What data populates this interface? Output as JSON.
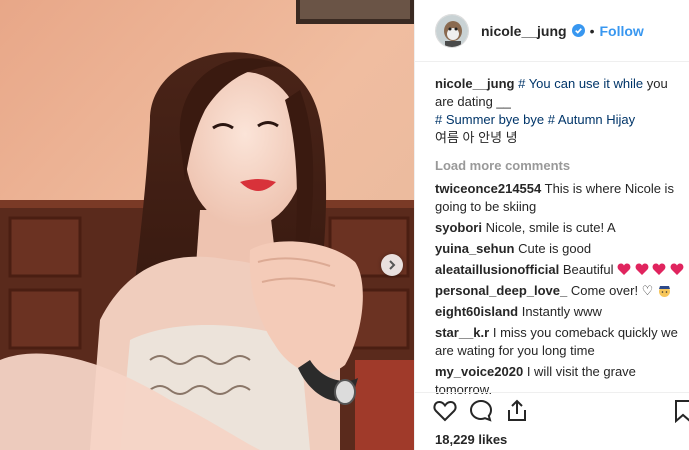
{
  "post": {
    "username": "nicole__jung",
    "follow_label": "Follow",
    "dot": "•",
    "caption": {
      "user": "nicole__jung",
      "parts": [
        "# You can use it",
        "while",
        "you are dating __"
      ],
      "line2": "# Summer bye bye # Autumn Hijay",
      "line3": "여름 아 안녕 녕"
    },
    "load_more": "Load more comments",
    "comments": [
      {
        "user": "twiceonce214554",
        "text": "This is where Nicole is going to be skiing"
      },
      {
        "user": "syobori",
        "text": "Nicole, smile is cute! A"
      },
      {
        "user": "yuina_sehun",
        "text": "Cute is good"
      },
      {
        "user": "aleataillusionofficial",
        "text": "Beautiful"
      },
      {
        "user": "personal_deep_love_",
        "text": "Come over! ♡"
      },
      {
        "user": "eight60island",
        "text": "Instantly www"
      },
      {
        "user": "star__k.r",
        "text": "I miss you comeback quickly we are wating for you long time"
      },
      {
        "user": "my_voice2020",
        "text": "I will visit the grave tomorrow."
      }
    ],
    "likes": "18,229 likes"
  },
  "icons": {
    "verified": "verified-badge-icon",
    "like": "heart-outline-icon",
    "comment": "speech-bubble-icon",
    "share": "share-upload-icon",
    "save": "bookmark-icon",
    "next": "chevron-right-icon"
  },
  "colors": {
    "link": "#3897f0",
    "hashtag": "#003569",
    "muted": "#999999",
    "heart_emoji": "#e0245e"
  }
}
